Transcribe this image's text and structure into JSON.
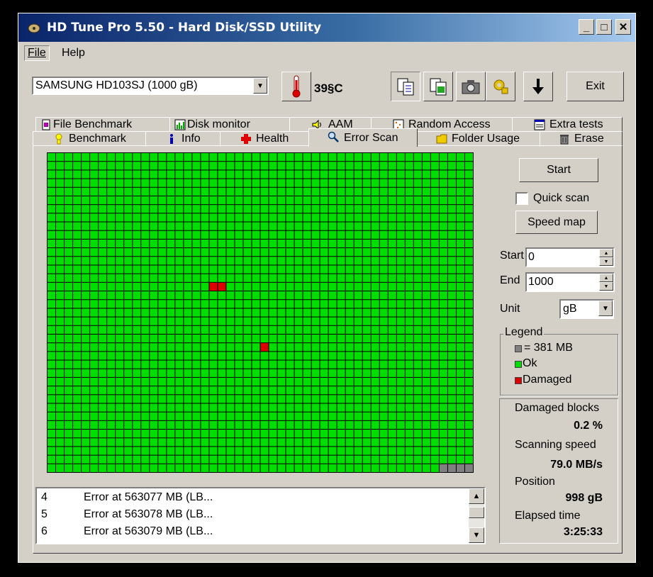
{
  "window": {
    "title": "HD Tune Pro 5.50 - Hard Disk/SSD Utility",
    "controls": {
      "minimize": "_",
      "maximize": "□",
      "close": "✕"
    }
  },
  "menu": {
    "file": "File",
    "help": "Help"
  },
  "toolbar": {
    "drive": "SAMSUNG HD103SJ (1000 gB)",
    "temperature": "39§C",
    "exit_label": "Exit",
    "icons": [
      "thermometer-icon",
      "copy-info-icon",
      "copy-screenshot-icon",
      "camera-icon",
      "options-icon",
      "save-icon"
    ]
  },
  "tabs": {
    "row_back": [
      {
        "label": "File Benchmark",
        "icon": "file-benchmark-icon"
      },
      {
        "label": "Disk monitor",
        "icon": "disk-monitor-icon"
      },
      {
        "label": "AAM",
        "icon": "speaker-icon"
      },
      {
        "label": "Random Access",
        "icon": "random-access-icon"
      },
      {
        "label": "Extra tests",
        "icon": "extra-tests-icon"
      }
    ],
    "row_front": [
      {
        "label": "Benchmark",
        "icon": "benchmark-icon"
      },
      {
        "label": "Info",
        "icon": "info-icon"
      },
      {
        "label": "Health",
        "icon": "health-icon"
      },
      {
        "label": "Error Scan",
        "icon": "magnifier-icon",
        "active": true
      },
      {
        "label": "Folder Usage",
        "icon": "folder-icon"
      },
      {
        "label": "Erase",
        "icon": "trash-icon"
      }
    ]
  },
  "scan_map": {
    "cols": 50,
    "rows": 37,
    "ok_color": "#00dd00",
    "damaged_color": "#dd0000",
    "unscanned_color": "#808080",
    "damaged_cells": [
      [
        15,
        19
      ],
      [
        15,
        20
      ],
      [
        22,
        25
      ]
    ],
    "unscanned_tail_count": 4
  },
  "log": {
    "rows": [
      {
        "num": "4",
        "text": "Error at 563077 MB (LB..."
      },
      {
        "num": "5",
        "text": "Error at 563078 MB (LB..."
      },
      {
        "num": "6",
        "text": "Error at 563079 MB (LB..."
      }
    ]
  },
  "controls": {
    "start_button": "Start",
    "quick_scan": "Quick scan",
    "quick_scan_checked": false,
    "speed_map_button": "Speed map",
    "start_label": "Start",
    "start_value": "0",
    "end_label": "End",
    "end_value": "1000",
    "unit_label": "Unit",
    "unit_value": "gB"
  },
  "legend": {
    "title": "Legend",
    "block": "= 381 MB",
    "ok": "Ok",
    "damaged": "Damaged"
  },
  "stats": {
    "damaged_blocks_label": "Damaged blocks",
    "damaged_blocks_value": "0.2 %",
    "scanning_speed_label": "Scanning speed",
    "scanning_speed_value": "79.0 MB/s",
    "position_label": "Position",
    "position_value": "998 gB",
    "elapsed_label": "Elapsed time",
    "elapsed_value": "3:25:33"
  }
}
